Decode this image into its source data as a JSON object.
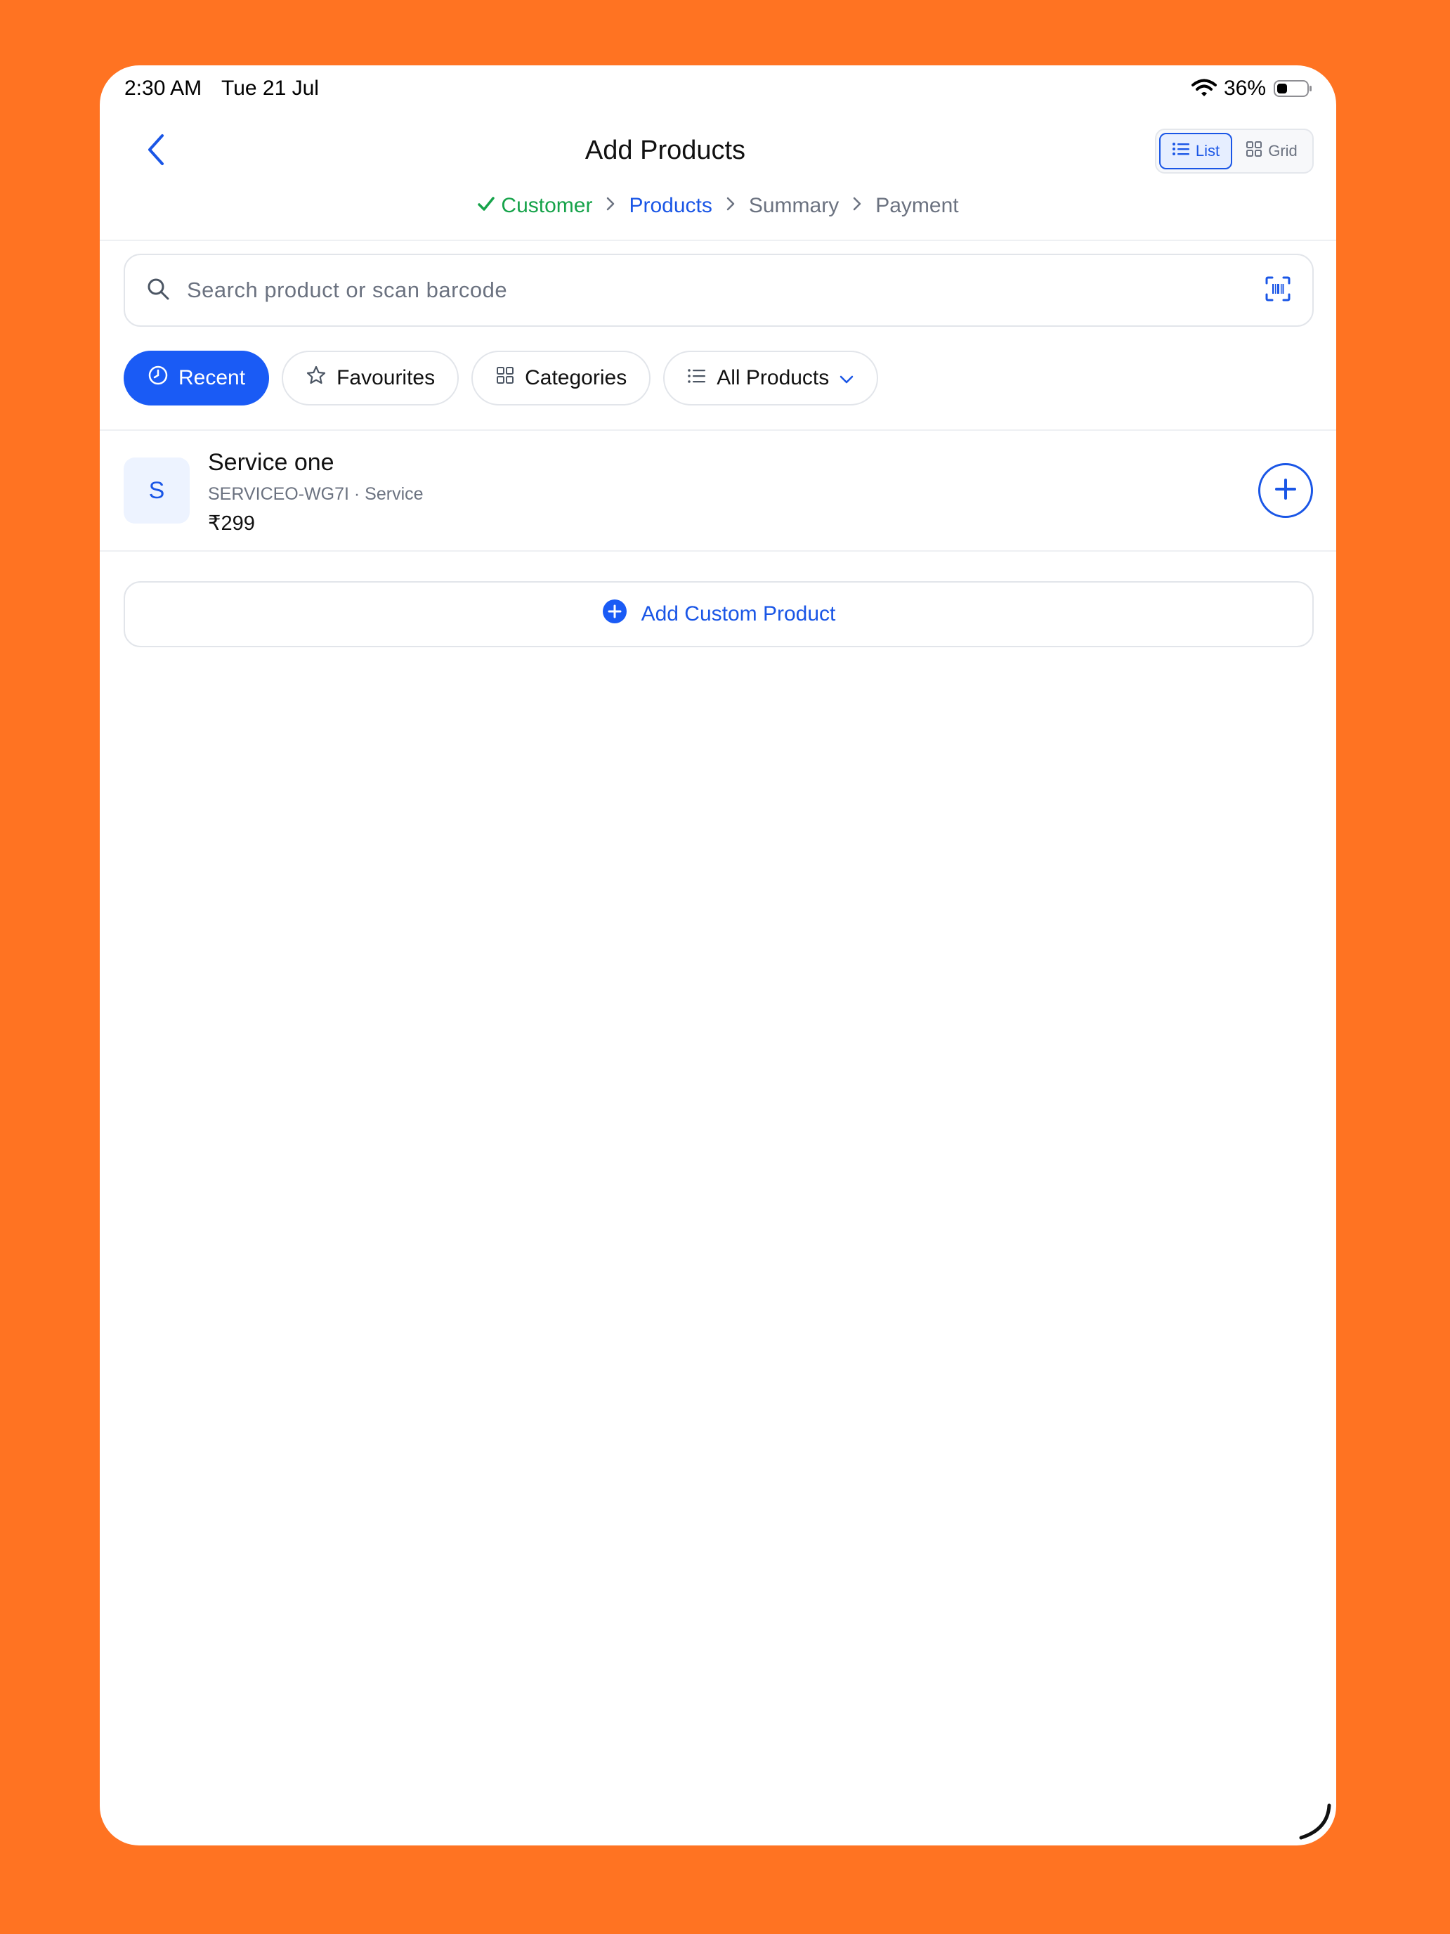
{
  "status_bar": {
    "time": "2:30 AM",
    "date": "Tue 21 Jul",
    "battery": "36%"
  },
  "header": {
    "title": "Add Products",
    "back_icon": "chevron-left-icon"
  },
  "view_toggle": {
    "list_label": "List",
    "grid_label": "Grid",
    "selected": "List"
  },
  "stepper": [
    {
      "label": "Customer",
      "state": "done"
    },
    {
      "label": "Products",
      "state": "active"
    },
    {
      "label": "Summary",
      "state": "pending"
    },
    {
      "label": "Payment",
      "state": "pending"
    }
  ],
  "search": {
    "placeholder": "Search product or scan barcode",
    "value": ""
  },
  "filters": {
    "recent": "Recent",
    "favourites": "Favourites",
    "categories": "Categories",
    "all_products": "All Products",
    "selected": "Recent"
  },
  "products": [
    {
      "initial": "S",
      "name": "Service one",
      "meta": "SERVICEO-WG7I · Service",
      "price": "₹299"
    }
  ],
  "add_custom_label": "Add Custom Product",
  "colors": {
    "accent": "#1A5BF5",
    "success": "#16A34A",
    "muted": "#6B7280",
    "background": "#FF7322"
  }
}
